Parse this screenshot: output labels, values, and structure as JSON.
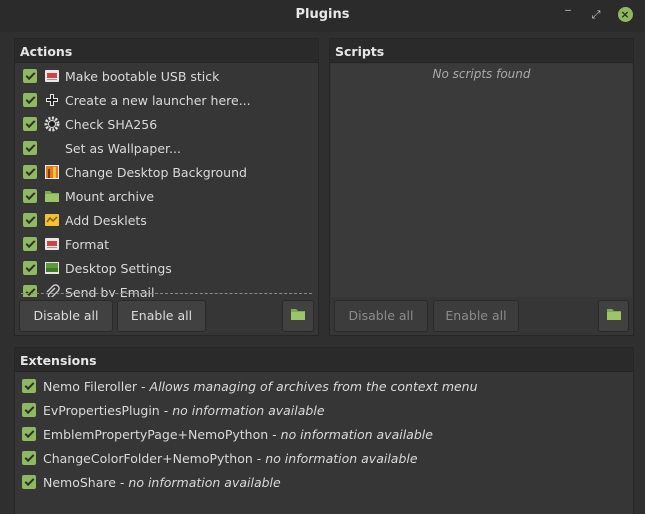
{
  "window": {
    "title": "Plugins",
    "minimize": "‾",
    "maximize": "⤢",
    "close": "×"
  },
  "actions": {
    "header": "Actions",
    "items": [
      {
        "label": "Make bootable USB stick",
        "icon": "usb-stick-icon"
      },
      {
        "label": "Create a new launcher here...",
        "icon": "plus-icon"
      },
      {
        "label": "Check SHA256",
        "icon": "gear-icon"
      },
      {
        "label": "Set as Wallpaper...",
        "icon": "none"
      },
      {
        "label": "Change Desktop Background",
        "icon": "desktop-background-icon"
      },
      {
        "label": "Mount archive",
        "icon": "folder-icon"
      },
      {
        "label": "Add Desklets",
        "icon": "desklet-icon"
      },
      {
        "label": "Format",
        "icon": "usb-stick-icon"
      },
      {
        "label": "Desktop Settings",
        "icon": "desktop-settings-icon"
      },
      {
        "label": "Send by Email",
        "icon": "paperclip-icon"
      }
    ],
    "disable_all": "Disable all",
    "enable_all": "Enable all"
  },
  "scripts": {
    "header": "Scripts",
    "empty_text": "No scripts found",
    "disable_all": "Disable all",
    "enable_all": "Enable all"
  },
  "extensions": {
    "header": "Extensions",
    "items": [
      {
        "name": "Nemo Fileroller",
        "desc": "Allows managing of archives from the context menu"
      },
      {
        "name": "EvPropertiesPlugin",
        "desc": "no information available"
      },
      {
        "name": "EmblemPropertyPage+NemoPython",
        "desc": "no information available"
      },
      {
        "name": "ChangeColorFolder+NemoPython",
        "desc": "no information available"
      },
      {
        "name": "NemoShare",
        "desc": "no information available"
      }
    ],
    "separator": " - "
  },
  "colors": {
    "accent": "#8fb95e",
    "background": "#2f2f2f",
    "panel": "#363636"
  }
}
